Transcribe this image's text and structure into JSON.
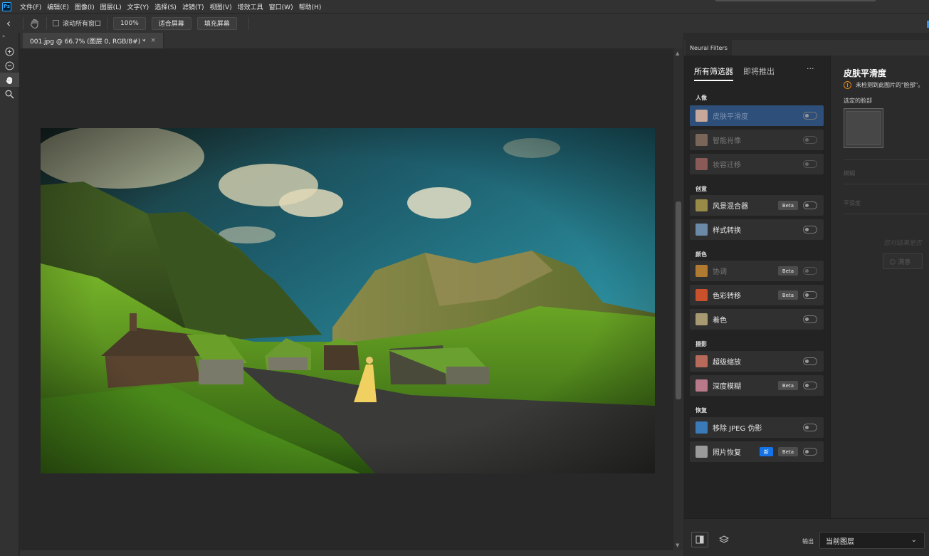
{
  "menubar": {
    "items": [
      "文件(F)",
      "编辑(E)",
      "图像(I)",
      "图层(L)",
      "文字(Y)",
      "选择(S)",
      "滤镜(T)",
      "视图(V)",
      "增效工具",
      "窗口(W)",
      "帮助(H)"
    ]
  },
  "options": {
    "scroll_all_label": "滚动所有窗口",
    "zoom_100": "100%",
    "fit_screen": "适合屏幕",
    "fill_screen": "填充屏幕"
  },
  "document": {
    "tab_title": "001.jpg @ 66.7% (图层 0, RGB/8#) *",
    "close_glyph": "×"
  },
  "neural_filters": {
    "panel_tab": "Neural Filters",
    "subtabs": [
      "所有筛选器",
      "即将推出"
    ],
    "more": "···",
    "categories": {
      "portrait": "人像",
      "creative": "创意",
      "color": "颜色",
      "photography": "摄影",
      "restoration": "恢复"
    },
    "filters": [
      {
        "label": "皮肤平滑度",
        "badge": "",
        "new": ""
      },
      {
        "label": "智能肖像",
        "badge": "",
        "new": ""
      },
      {
        "label": "妆容迁移",
        "badge": "",
        "new": ""
      },
      {
        "label": "风景混合器",
        "badge": "Beta",
        "new": ""
      },
      {
        "label": "样式转换",
        "badge": "",
        "new": ""
      },
      {
        "label": "协调",
        "badge": "Beta",
        "new": ""
      },
      {
        "label": "色彩转移",
        "badge": "Beta",
        "new": ""
      },
      {
        "label": "着色",
        "badge": "",
        "new": ""
      },
      {
        "label": "超级缩放",
        "badge": "",
        "new": ""
      },
      {
        "label": "深度模糊",
        "badge": "Beta",
        "new": ""
      },
      {
        "label": "移除 JPEG 伪影",
        "badge": "",
        "new": ""
      },
      {
        "label": "照片恢复",
        "badge": "Beta",
        "new": "新"
      }
    ],
    "detail": {
      "title": "皮肤平滑度",
      "warning_icon": "!",
      "warning": "未检测到此图片的\"脸部\"。",
      "selected_face_label": "选定的脸部",
      "slider1_label": "模糊",
      "slider2_label": "平滑度",
      "feedback_prompt": "您对结果是否",
      "feedback_button": "☺ 满意"
    },
    "output_label": "输出",
    "output_value": "当前图层"
  },
  "colors": {
    "accent": "#1473e6",
    "selected_row": "#2e4f7a",
    "warning": "#e68619"
  }
}
